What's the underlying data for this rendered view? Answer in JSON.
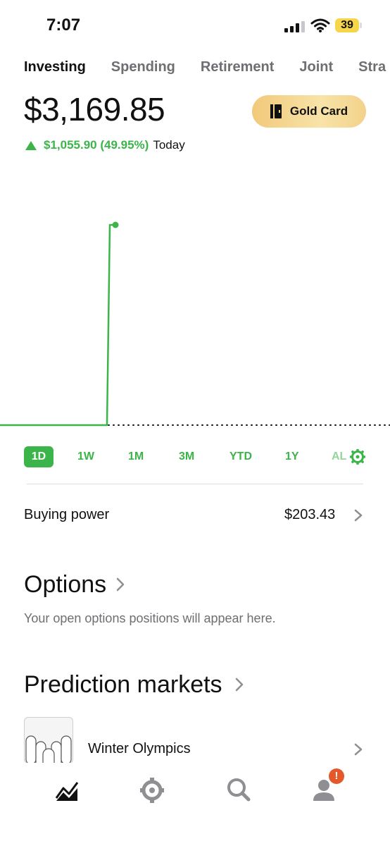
{
  "status_bar": {
    "time": "7:07",
    "battery": "39"
  },
  "tabs": [
    {
      "label": "Investing",
      "active": true
    },
    {
      "label": "Spending",
      "active": false
    },
    {
      "label": "Retirement",
      "active": false
    },
    {
      "label": "Joint",
      "active": false
    },
    {
      "label": "Stra",
      "active": false
    }
  ],
  "portfolio": {
    "value": "$3,169.85",
    "change": "$1,055.90 (49.95%)",
    "change_period": "Today",
    "gold_card_label": "Gold Card"
  },
  "ranges": [
    "1D",
    "1W",
    "1M",
    "3M",
    "YTD",
    "1Y",
    "AL"
  ],
  "buying_power": {
    "label": "Buying power",
    "value": "$203.43"
  },
  "options": {
    "title": "Options",
    "subtitle": "Your open options positions will appear here."
  },
  "prediction_markets": {
    "title": "Prediction markets",
    "item_label": "Winter Olympics"
  },
  "nav": {
    "items": [
      "chart-icon",
      "crypto-icon",
      "search-icon",
      "account-icon"
    ],
    "notification_badge": "!"
  },
  "colors": {
    "accent": "#3bb54a",
    "badge": "#e4582a",
    "gold": "#f1c97a"
  }
}
